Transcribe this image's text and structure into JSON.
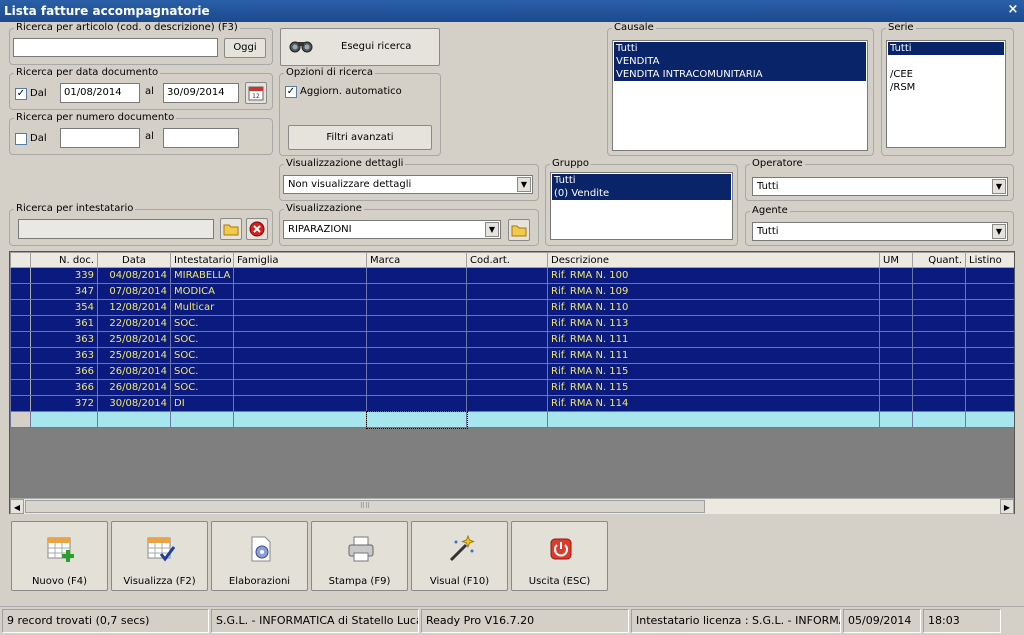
{
  "window": {
    "title": "Lista fatture accompagnatorie",
    "close_glyph": "×"
  },
  "search_article": {
    "legend": "Ricerca per articolo (cod. o descrizione) (F3)",
    "value": "",
    "today_button": "Oggi"
  },
  "exec_search": {
    "label": "Esegui ricerca"
  },
  "search_date": {
    "legend": "Ricerca per data documento",
    "dal_label": "Dal",
    "dal_checked": true,
    "from": "01/08/2014",
    "al_label": "al",
    "to": "30/09/2014"
  },
  "search_options": {
    "legend": "Opzioni di ricerca",
    "auto_label": "Aggiorn. automatico",
    "auto_checked": true,
    "advanced_button": "Filtri avanzati"
  },
  "search_number": {
    "legend": "Ricerca per numero documento",
    "dal_label": "Dal",
    "dal_checked": false,
    "from": "",
    "al_label": "al",
    "to": ""
  },
  "causale": {
    "legend": "Causale",
    "items": [
      "Tutti",
      "VENDITA",
      "VENDITA INTRACOMUNITARIA"
    ]
  },
  "serie": {
    "legend": "Serie",
    "items": [
      "Tutti",
      "",
      "/CEE",
      "/RSM"
    ]
  },
  "view_details": {
    "legend": "Visualizzazione dettagli",
    "value": "Non visualizzare dettagli"
  },
  "gruppo": {
    "legend": "Gruppo",
    "items": [
      "Tutti",
      "(0) Vendite"
    ]
  },
  "operatore": {
    "legend": "Operatore",
    "value": "Tutti"
  },
  "search_holder": {
    "legend": "Ricerca per intestatario",
    "value": ""
  },
  "visualizzazione": {
    "legend": "Visualizzazione",
    "value": "RIPARAZIONI"
  },
  "agente": {
    "legend": "Agente",
    "value": "Tutti"
  },
  "grid": {
    "columns": [
      "",
      "N. doc.",
      "Data",
      "Intestatario",
      "Famiglia",
      "Marca",
      "Cod.art.",
      "Descrizione",
      "UM",
      "Quant.",
      "Listino"
    ],
    "rows": [
      [
        "339",
        "04/08/2014",
        "MIRABELLA",
        "",
        "",
        "",
        "Rif. RMA N. 100",
        "",
        "",
        ""
      ],
      [
        "347",
        "07/08/2014",
        "MODICA",
        "",
        "",
        "",
        "Rif. RMA N. 109",
        "",
        "",
        ""
      ],
      [
        "354",
        "12/08/2014",
        "Multicar",
        "",
        "",
        "",
        "Rif. RMA N. 110",
        "",
        "",
        ""
      ],
      [
        "361",
        "22/08/2014",
        "SOC.",
        "",
        "",
        "",
        "Rif. RMA N. 113",
        "",
        "",
        ""
      ],
      [
        "363",
        "25/08/2014",
        "SOC.",
        "",
        "",
        "",
        "Rif. RMA N. 111",
        "",
        "",
        ""
      ],
      [
        "363",
        "25/08/2014",
        "SOC.",
        "",
        "",
        "",
        "Rif. RMA N. 111",
        "",
        "",
        ""
      ],
      [
        "366",
        "26/08/2014",
        "SOC.",
        "",
        "",
        "",
        "Rif. RMA N. 115",
        "",
        "",
        ""
      ],
      [
        "366",
        "26/08/2014",
        "SOC.",
        "",
        "",
        "",
        "Rif. RMA N. 115",
        "",
        "",
        ""
      ],
      [
        "372",
        "30/08/2014",
        "DI",
        "",
        "",
        "",
        "Rif. RMA N. 114",
        "",
        "",
        ""
      ]
    ]
  },
  "actions": [
    {
      "label": "Nuovo (F4)",
      "icon": "new-grid-icon"
    },
    {
      "label": "Visualizza (F2)",
      "icon": "view-grid-icon"
    },
    {
      "label": "Elaborazioni",
      "icon": "process-gear-icon"
    },
    {
      "label": "Stampa (F9)",
      "icon": "printer-icon"
    },
    {
      "label": "Visual (F10)",
      "icon": "magic-wand-icon"
    },
    {
      "label": "Uscita (ESC)",
      "icon": "power-icon"
    }
  ],
  "status": {
    "records": "9 record trovati (0,7 secs)",
    "company": "S.G.L. - INFORMATICA di Statello Luca",
    "version": "Ready Pro V16.7.20",
    "license": "Intestatario licenza : S.G.L. - INFORMATICA",
    "date": "05/09/2014",
    "time": "18:03"
  },
  "colors": {
    "selection": "#0a246a",
    "grid_row_bg": "#0a1a7e",
    "grid_row_text": "#f5e86a",
    "new_row": "#a7e6ef"
  }
}
